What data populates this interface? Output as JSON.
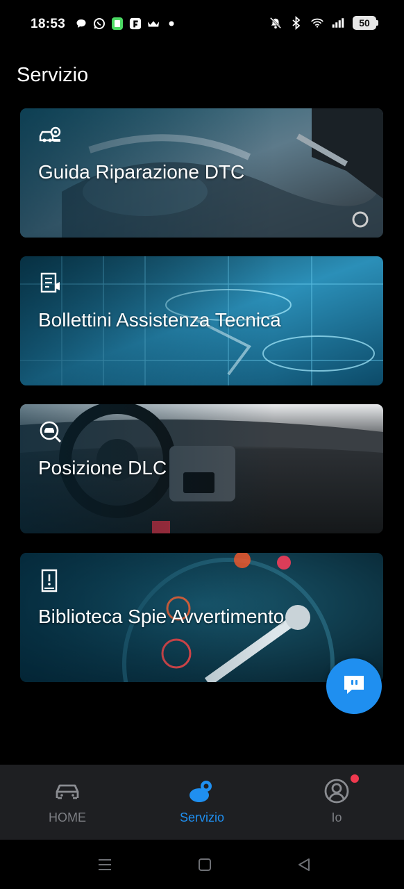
{
  "status_bar": {
    "time": "18:53",
    "battery": "50",
    "left_icons": [
      "chat-bubble-icon",
      "whatsapp-icon",
      "green-app-icon",
      "f-app-icon",
      "crown-icon",
      "dot-icon"
    ],
    "right_icons": [
      "mute-bell-icon",
      "bluetooth-icon",
      "wifi-icon",
      "signal-icon"
    ]
  },
  "page": {
    "title": "Servizio"
  },
  "cards": [
    {
      "label": "Guida Riparazione DTC",
      "icon": "car-search-icon"
    },
    {
      "label": "Bollettini Assistenza Tecnica",
      "icon": "bulletin-icon"
    },
    {
      "label": "Posizione DLC",
      "icon": "magnifier-car-icon"
    },
    {
      "label": "Biblioteca Spie Avvertimento",
      "icon": "warning-book-icon"
    }
  ],
  "fab": {
    "icon": "chat-icon"
  },
  "bottom_nav": {
    "items": [
      {
        "label": "HOME",
        "icon": "car-icon",
        "active": false
      },
      {
        "label": "Servizio",
        "icon": "service-icon",
        "active": true
      },
      {
        "label": "Io",
        "icon": "profile-icon",
        "active": false
      }
    ]
  },
  "colors": {
    "accent": "#1f8ff0",
    "nav_background": "#1e1f22",
    "inactive": "#7d7f84",
    "badge": "#f0394f"
  }
}
